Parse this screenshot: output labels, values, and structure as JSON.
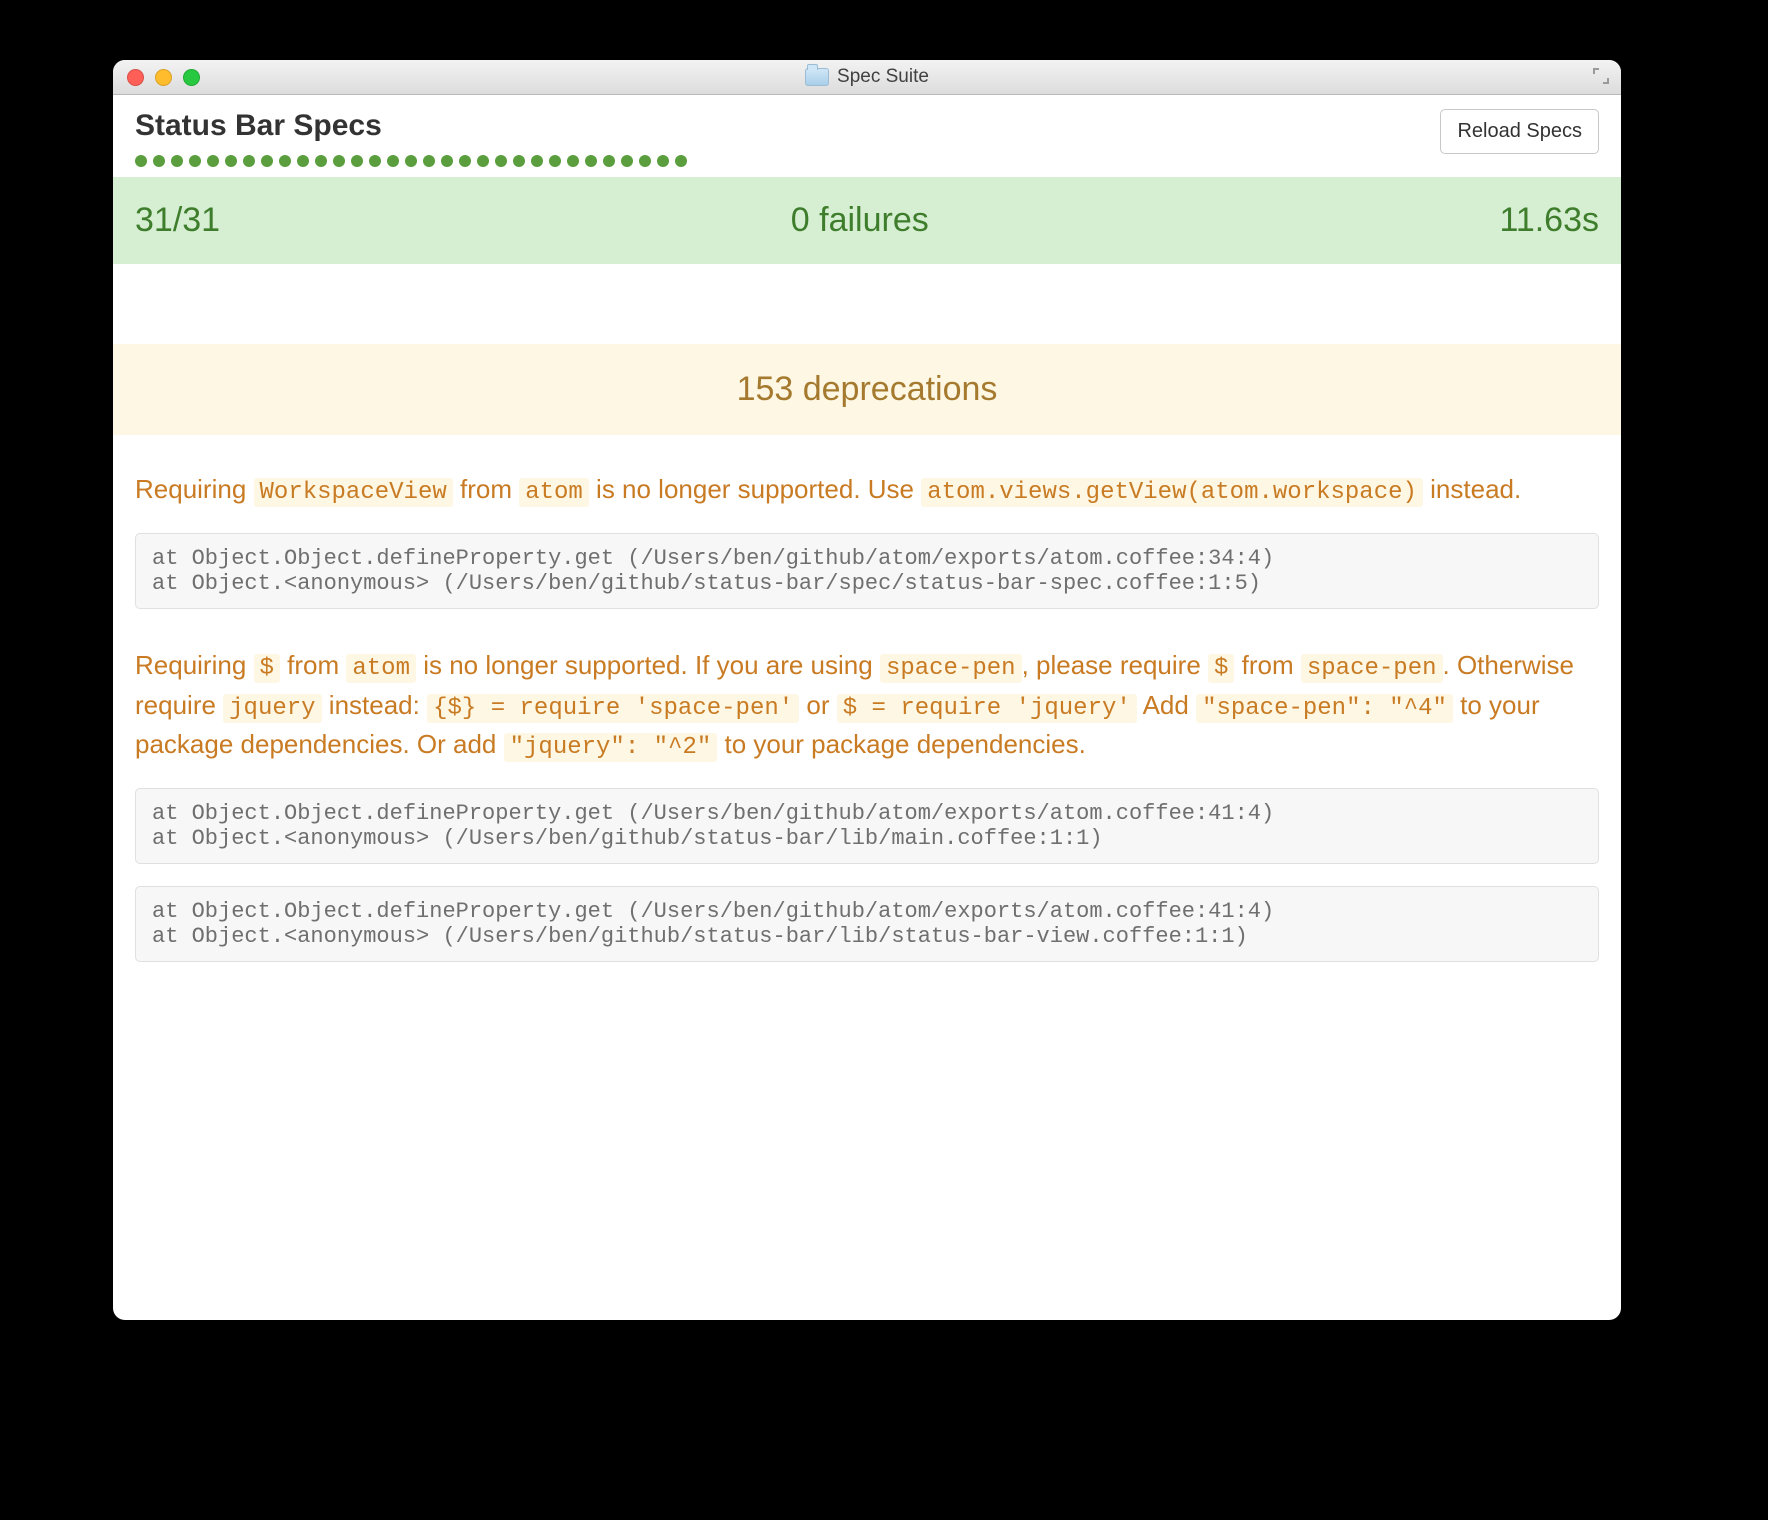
{
  "window": {
    "title": "Spec Suite"
  },
  "header": {
    "title": "Status Bar Specs",
    "reload_label": "Reload Specs",
    "dot_count": 31
  },
  "status": {
    "progress": "31/31",
    "failures": "0 failures",
    "time": "11.63s"
  },
  "deprecations": {
    "headline": "153 deprecations"
  },
  "dep1": {
    "p_requiring": "Requiring ",
    "c_workspaceview": "WorkspaceView",
    "p_from": " from ",
    "c_atom": "atom",
    "p_nolonger": " is no longer supported. Use ",
    "c_getview": "atom.views.getView(atom.workspace)",
    "p_instead": " instead.",
    "trace": "at Object.Object.defineProperty.get (/Users/ben/github/atom/exports/atom.coffee:34:4)\nat Object.<anonymous> (/Users/ben/github/status-bar/spec/status-bar-spec.coffee:1:5)"
  },
  "dep2": {
    "p_requiring": "Requiring ",
    "c_dollar": "$",
    "p_from": " from ",
    "c_atom": "atom",
    "p_nolonger": " is no longer supported. If you are using ",
    "c_spacepen": "space-pen",
    "p_please": ", please require ",
    "c_dollar2": "$",
    "p_from2": " from ",
    "c_spacepen2": "space-pen",
    "p_otherwise": ". Otherwise require ",
    "c_jquery": "jquery",
    "p_instead": " instead: ",
    "c_reqsp": "{$} = require 'space-pen'",
    "p_or": " or ",
    "c_reqjq": "$ = require 'jquery'",
    "p_add": " Add ",
    "c_sp4": "\"space-pen\": \"^4\"",
    "p_todeps": " to your package dependencies. Or add ",
    "c_jq2": "\"jquery\": \"^2\"",
    "p_todeps2": " to your package dependencies.",
    "trace1": "at Object.Object.defineProperty.get (/Users/ben/github/atom/exports/atom.coffee:41:4)\nat Object.<anonymous> (/Users/ben/github/status-bar/lib/main.coffee:1:1)",
    "trace2": "at Object.Object.defineProperty.get (/Users/ben/github/atom/exports/atom.coffee:41:4)\nat Object.<anonymous> (/Users/ben/github/status-bar/lib/status-bar-view.coffee:1:1)"
  }
}
